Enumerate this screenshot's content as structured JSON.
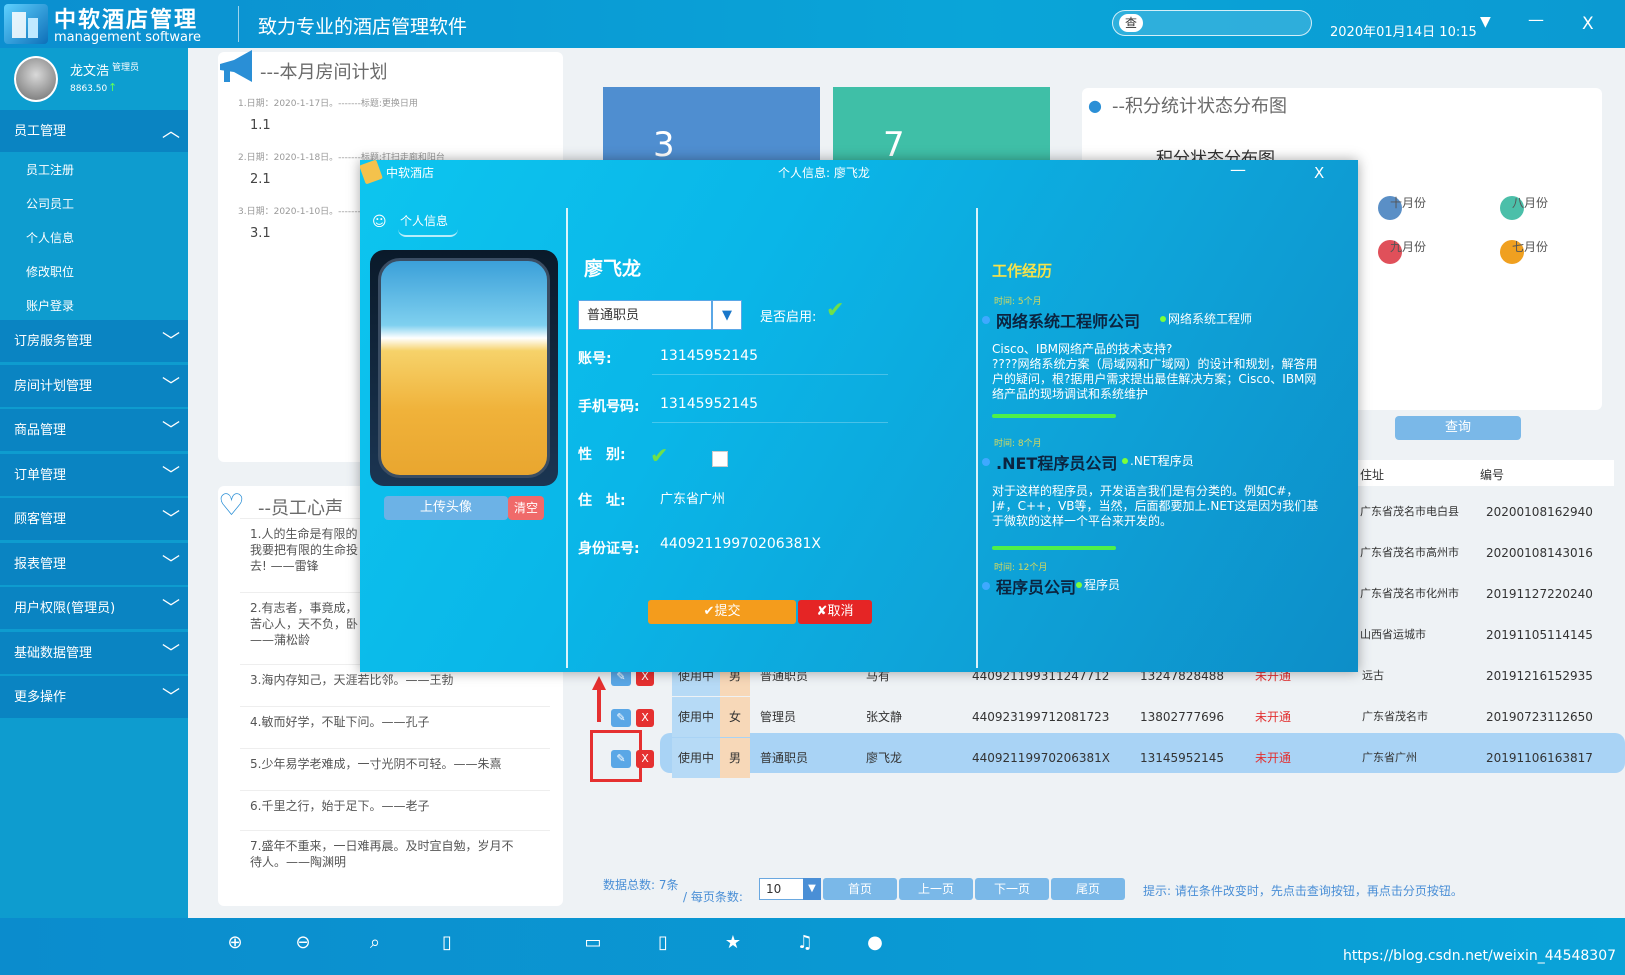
{
  "header": {
    "title": "中软酒店管理",
    "subtitle": "management software",
    "slogan": "致力专业的酒店管理软件",
    "search_label": "查",
    "search_placeholder": "",
    "datetime": "2020年01月14日 10:15"
  },
  "user": {
    "name": "龙文浩",
    "role": "管理员",
    "points": "8863.50"
  },
  "sidebar": {
    "sections": [
      {
        "label": "员工管理",
        "expanded": true
      },
      {
        "label": "订房服务管理"
      },
      {
        "label": "房间计划管理"
      },
      {
        "label": "商品管理"
      },
      {
        "label": "订单管理"
      },
      {
        "label": "顾客管理"
      },
      {
        "label": "报表管理"
      },
      {
        "label": "用户权限(管理员)"
      },
      {
        "label": "基础数据管理"
      },
      {
        "label": "更多操作"
      }
    ],
    "sub_items": [
      "员工注册",
      "公司员工",
      "个人信息",
      "修改职位",
      "账户登录"
    ]
  },
  "plan": {
    "title": "---本月房间计划",
    "rows": [
      {
        "date": "1.日期：2020-1-17日。-------标题:更换日用",
        "item": "1.1"
      },
      {
        "date": "2.日期：2020-1-18日。-------标题:打扫走廊和阳台",
        "item": "2.1"
      },
      {
        "date": "3.日期：2020-1-10日。-------标题:",
        "item": "3.1"
      }
    ]
  },
  "heart": {
    "title": "--员工心声",
    "quotes": [
      "1.人的生命是有限的\n我要把有限的生命投\n去! ——雷锋",
      "2.有志者，事竟成，\n苦心人，天不负，卧\n——蒲松龄",
      "3.海内存知己，天涯若比邻。——王勃",
      "4.敏而好学，不耻下问。——孔子",
      "5.少年易学老难成，一寸光阴不可轻。——朱熹",
      "6.千里之行，始于足下。——老子",
      "7.盛年不重来，一日难再晨。及时宜自勉，岁月不\n待人。——陶渊明"
    ]
  },
  "stats": {
    "card1": "3",
    "card2": "7"
  },
  "score": {
    "title": "--积分统计状态分布图",
    "chart_title": "积分状态分布图",
    "legend": [
      {
        "label": "十月份",
        "color": "#5a8fc6"
      },
      {
        "label": "八月份",
        "color": "#4bbfa9"
      },
      {
        "label": "九月份",
        "color": "#e0505a"
      },
      {
        "label": "七月份",
        "color": "#f0a020"
      }
    ]
  },
  "query_label": "查询",
  "table": {
    "headers": {
      "address": "住址",
      "number": "编号"
    },
    "status_open": "使用中",
    "not_open": "未开通",
    "top_rows": [
      {
        "address": "广东省茂名市电白县",
        "number": "20200108162940"
      },
      {
        "address": "广东省茂名市高州市",
        "number": "20200108143016"
      },
      {
        "address": "广东省茂名市化州市",
        "number": "20191127220240"
      },
      {
        "address": "山西省运城市",
        "number": "20191105114145"
      }
    ],
    "rows": [
      {
        "status": "使用中",
        "gender": "男",
        "position": "普通职员",
        "name": "马有",
        "id_card": "440921199311247712",
        "phone": "13247828488",
        "open": "未开通",
        "address": "远古",
        "number": "20191216152935"
      },
      {
        "status": "使用中",
        "gender": "女",
        "position": "管理员",
        "name": "张文静",
        "id_card": "440923199712081723",
        "phone": "13802777696",
        "open": "未开通",
        "address": "广东省茂名市",
        "number": "20190723112650"
      },
      {
        "status": "使用中",
        "gender": "男",
        "position": "普通职员",
        "name": "廖飞龙",
        "id_card": "44092119970206381X",
        "phone": "13145952145",
        "open": "未开通",
        "address": "广东省广州",
        "number": "20191106163817"
      }
    ],
    "edit_label": "✎",
    "delete_label": "X"
  },
  "pager": {
    "total_label": "数据总数: 7条",
    "per_page_label": "/ 每页条数:",
    "page_size": "10",
    "first": "首页",
    "prev": "上一页",
    "next": "下一页",
    "last": "尾页",
    "tip": "提示: 请在条件改变时，先点击查询按钮，再点击分页按钮。"
  },
  "watermark": "https://blog.csdn.net/weixin_44548307",
  "modal": {
    "app_name": "中软酒店",
    "title": "个人信息: 廖飞龙",
    "tab": "个人信息",
    "upload": "上传头像",
    "clear": "清空",
    "name": "廖飞龙",
    "position": "普通职员",
    "enabled_label": "是否启用:",
    "account_label": "账号:",
    "account": "13145952145",
    "phone_label": "手机号码:",
    "phone": "13145952145",
    "gender_label": "性　别:",
    "address_label": "住　址:",
    "address": "广东省广州",
    "idcard_label": "身份证号:",
    "idcard": "44092119970206381X",
    "submit": "✔提交",
    "cancel": "✘取消",
    "work_title": "工作经历",
    "work": [
      {
        "time": "时间: 5个月",
        "company": "网络系统工程师公司",
        "role": "网络系统工程师",
        "desc": "Cisco、IBM网络产品的技术支持?\n????网络系统方案（局域网和广域网）的设计和规划，解答用户的疑问，根?据用户需求提出最佳解决方案；Cisco、IBM网络产品的现场调试和系统维护"
      },
      {
        "time": "时间: 8个月",
        "company": ".NET程序员公司",
        "role": ".NET程序员",
        "desc": "对于这样的程序员，开发语言我们是有分类的。例如C#，J#，C++，VB等，当然，后面都要加上.NET这是因为我们基于微软的这样一个平台来开发的。"
      },
      {
        "time": "时间: 12个月",
        "company": "程序员公司",
        "role": "程序员",
        "desc": ""
      }
    ]
  }
}
